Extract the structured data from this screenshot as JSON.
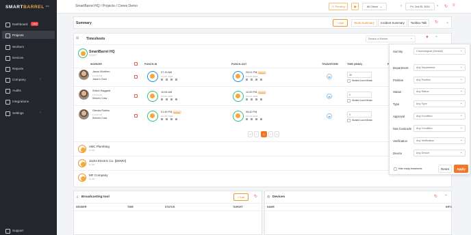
{
  "brand": {
    "logo_part1": "SMART",
    "logo_part2": "BARREL",
    "logo_suffix": "EN"
  },
  "sidebar": {
    "items": [
      {
        "label": "Dashboard",
        "badge": "NEW"
      },
      {
        "label": "Projects"
      },
      {
        "label": "Workers"
      },
      {
        "label": "Devices"
      },
      {
        "label": "Reports"
      },
      {
        "label": "Company"
      },
      {
        "label": "Audits"
      },
      {
        "label": "Integrations"
      },
      {
        "label": "Settings"
      }
    ],
    "support": "Support"
  },
  "topbar": {
    "breadcrumb": "SmartBarrel HQ  /  Projects  /  Crews Demo",
    "pending": "Pending",
    "all_check": "All Check",
    "date": "Fri, Oct 25, 2024"
  },
  "summary": {
    "title": "Summary",
    "add": "+ Add",
    "tabs": [
      "Work Summary",
      "Incident Summary",
      "Toolbox Talk"
    ]
  },
  "timesheets": {
    "title": "Timesheets",
    "search_placeholder": "Search a Worker",
    "company": "SmartBarrel HQ",
    "company_sub": "3 | 0/17",
    "columns": [
      "WORKER",
      "PUNCH-IN",
      "PUNCH-OUT",
      "TRANSFORM",
      "TIME (MINS)",
      "PI"
    ],
    "rows": [
      {
        "name": "Jason Worthen",
        "sub": "1.0.0.0.0.0",
        "crew": "Jason's Crew",
        "punch_in": "07:15 AM",
        "in_date": "Oct 25, 2024",
        "punch_out": "03:21 PM",
        "out_tag": "Outside",
        "out_date": "Oct 25, 2024",
        "time": "30",
        "lunch": "Worked Lunch Break"
      },
      {
        "name": "Shiloh Haggard",
        "sub": "1.0.0.0.0.0",
        "crew": "Shiloh's Crew",
        "punch_in": "10:06 AM",
        "in_date": "Oct 25, 2024",
        "punch_out": "12:00 PM",
        "out_tag": "Outside",
        "out_date": "Oct 25, 2024",
        "time": "0",
        "lunch": "Worked Lunch Break"
      },
      {
        "name": "Glenda Robles",
        "sub": "1.0.0.0.0.0",
        "crew": "Shiloh's Crew",
        "punch_in": "01:45 PM",
        "in_tag": "Outside",
        "in_date": "Oct 25, 2024",
        "punch_out": "09:40 PM",
        "out_date": "Oct 25, 2024",
        "time": "0",
        "lunch": "Worked Lunch Break"
      }
    ],
    "pagination": {
      "current": "1"
    },
    "other_companies": [
      {
        "name": "ABC Plumbing",
        "sub": "0 | 0/4"
      },
      {
        "name": "Jacks Electric Co. [DEMO]",
        "sub": "0 | 0/4"
      },
      {
        "name": "MF Company",
        "sub": "0 | 0/2"
      }
    ]
  },
  "broadcasting": {
    "title": "Broadcasting tool",
    "add": "+ Add",
    "columns": [
      "SENDER",
      "TIME",
      "STATUS",
      "TARGET"
    ]
  },
  "devices": {
    "title": "Devices",
    "columns": [
      "NAME",
      "INFO"
    ]
  },
  "filters": {
    "fields": [
      {
        "label": "Sort By",
        "value": "Chronological (Default)"
      },
      {
        "label": "Department",
        "value": "Any Department"
      },
      {
        "label": "Position",
        "value": "Any Position"
      },
      {
        "label": "Status",
        "value": "Any Status"
      },
      {
        "label": "Type",
        "value": "Any Type"
      },
      {
        "label": "Approval",
        "value": "Any Condition"
      },
      {
        "label": "Has Costcode",
        "value": "Any Condition"
      },
      {
        "label": "Verification",
        "value": "Any Verification"
      },
      {
        "label": "Device",
        "value": "Any Device"
      }
    ],
    "hide_empty": "Hide empty timesheets",
    "reset": "Reset",
    "apply": "Apply"
  },
  "colors": {
    "accent": "#f0962a",
    "apply": "#f0762a",
    "sidebar": "#23262d"
  }
}
